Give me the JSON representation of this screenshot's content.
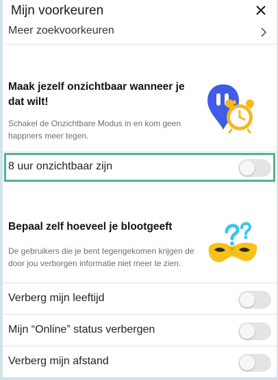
{
  "header": {
    "title": "Mijn voorkeuren",
    "close_icon": "close-icon"
  },
  "cutoff_row": {
    "label": "Meer zoekvoorkeuren",
    "icon": "chevron-right-icon"
  },
  "invisible_section": {
    "title": "Maak jezelf onzichtbaar wanneer je dat wilt!",
    "description": "Schakel de Onzichtbare Modus in en kom geen happners meer tegen.",
    "illustration": "invisible-pin-alarm-clock-icon",
    "toggle_label": "8 uur onzichtbaar zijn",
    "toggle_on": false,
    "highlight_color": "#52b28f"
  },
  "exposure_section": {
    "title": "Bepaal zelf hoeveel je blootgeeft",
    "description": "De gebruikers die je bent tegengekomen krijgen de door jou verborgen informatie niet meer te zien.",
    "illustration": "mask-question-marks-icon",
    "toggles": [
      {
        "label": "Verberg mijn leeftijd",
        "on": false
      },
      {
        "label": "Mijn “Online” status verbergen",
        "on": false
      },
      {
        "label": "Verberg mijn afstand",
        "on": false
      }
    ]
  },
  "colors": {
    "background": "#d3e3ea",
    "pin_blue": "#3f5be8",
    "clock_yellow": "#f5b81c",
    "mask_yellow": "#f6c21a",
    "question_cyan": "#3ac6e6"
  }
}
